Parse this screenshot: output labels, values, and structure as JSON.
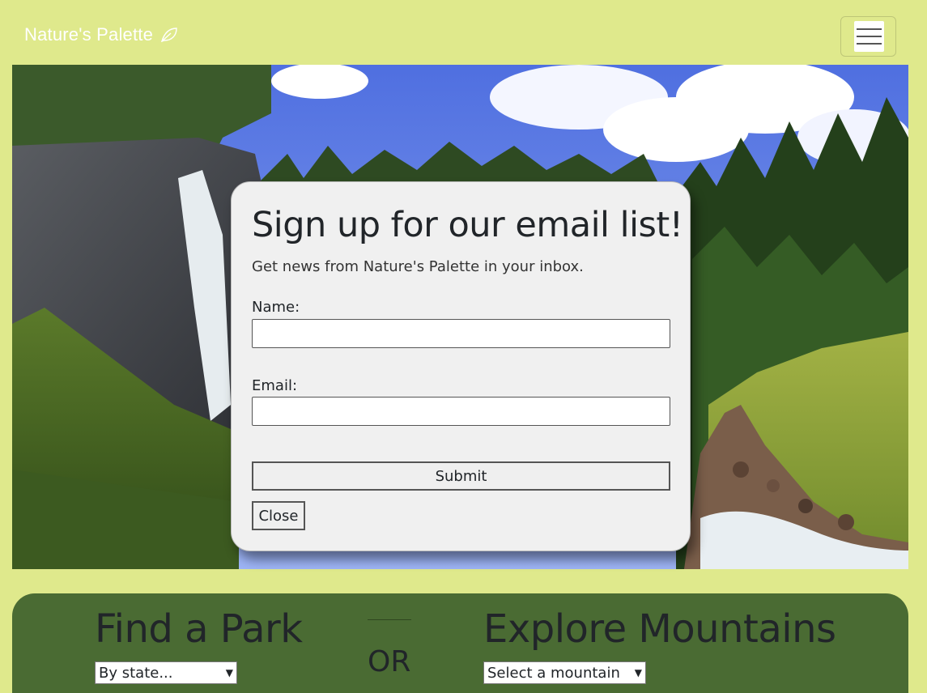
{
  "navbar": {
    "brand": "Nature's Palette",
    "brand_icon": "leaf-icon",
    "menu_icon": "hamburger-menu-icon"
  },
  "modal": {
    "title": "Sign up for our email list!",
    "subtitle": "Get news from Nature's Palette in your inbox.",
    "name_label": "Name:",
    "name_value": "",
    "email_label": "Email:",
    "email_value": "",
    "submit_label": "Submit",
    "close_label": "Close"
  },
  "explore": {
    "park_title": "Find a Park",
    "park_select": "By state...",
    "or_text": "OR",
    "mountain_title": "Explore Mountains",
    "mountain_select": "Select a mountain"
  },
  "colors": {
    "page_bg": "#dfe98c",
    "panel_green": "#4a6b33",
    "modal_bg": "#f0f0f0"
  }
}
